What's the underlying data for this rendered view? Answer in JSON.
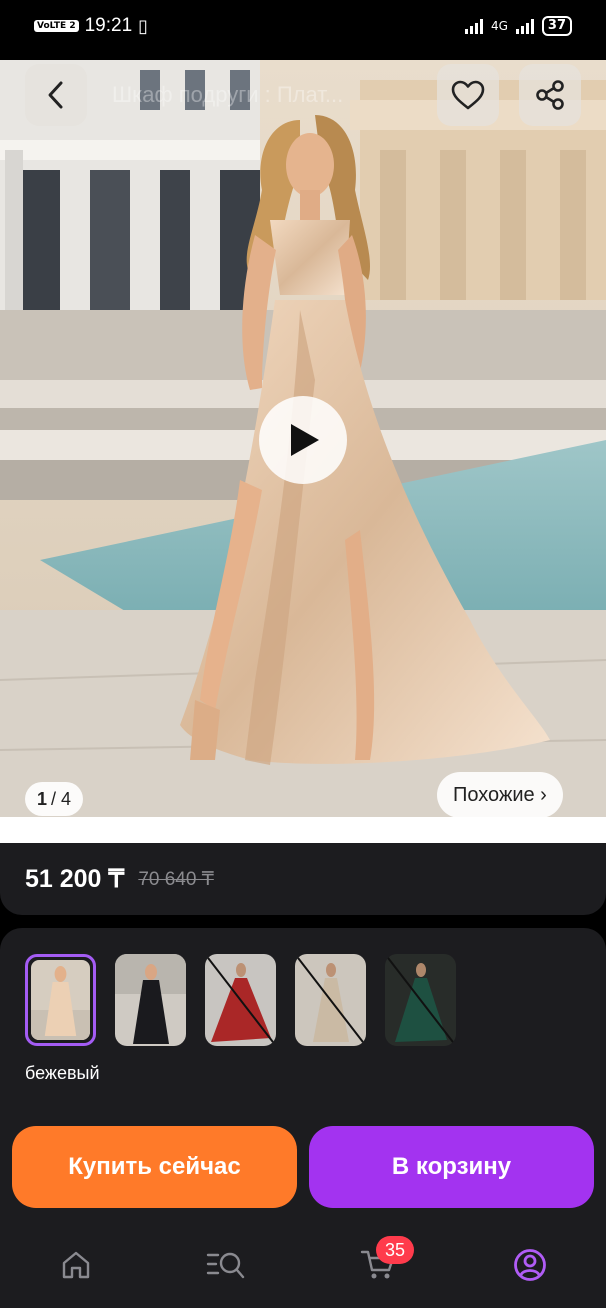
{
  "status_bar": {
    "volte": "VoLTE 2",
    "time": "19:21",
    "network": "4G",
    "battery": "37"
  },
  "header": {
    "title": "Шкаф подруги : Плат..."
  },
  "gallery": {
    "current": "1",
    "total": "/ 4",
    "similar_label": "Похожие ›"
  },
  "price": {
    "current": "51 200 ₸",
    "old": "70 640 ₸"
  },
  "variants": {
    "selected_color": "бежевый",
    "items": [
      {
        "name": "beige",
        "selected": true,
        "available": true
      },
      {
        "name": "black",
        "selected": false,
        "available": true
      },
      {
        "name": "red",
        "selected": false,
        "available": false
      },
      {
        "name": "champagne",
        "selected": false,
        "available": false
      },
      {
        "name": "green",
        "selected": false,
        "available": false
      }
    ]
  },
  "actions": {
    "buy_now": "Купить сейчас",
    "add_to_cart": "В корзину"
  },
  "bottom_nav": {
    "cart_badge": "35",
    "items": [
      "home-icon",
      "catalog-search-icon",
      "cart-icon",
      "profile-icon"
    ],
    "active": "profile-icon"
  },
  "colors": {
    "buy_button": "#ff7a29",
    "cart_button": "#a333f0",
    "selected_border": "#a45cf4",
    "badge": "#ff3b4c",
    "card_bg": "#1c1c1f"
  }
}
